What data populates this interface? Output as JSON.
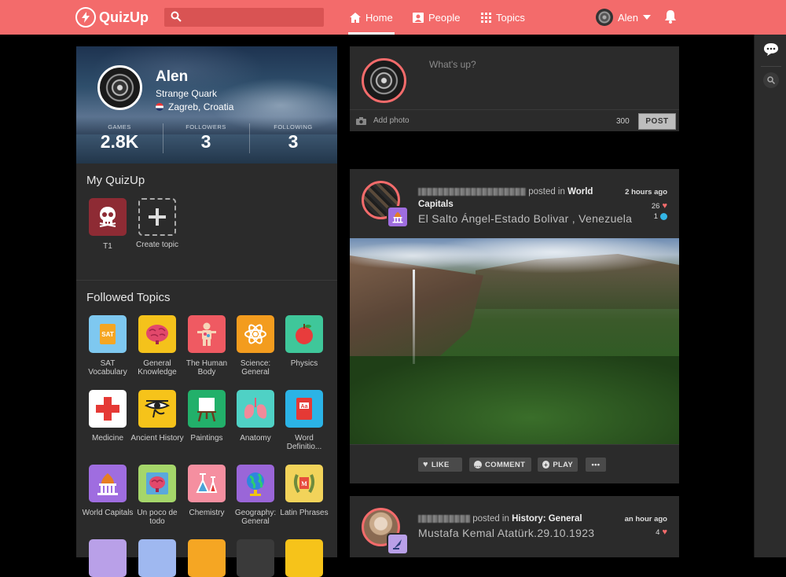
{
  "app": {
    "name": "QuizUp"
  },
  "search": {
    "placeholder": ""
  },
  "nav": {
    "home": "Home",
    "people": "People",
    "topics": "Topics"
  },
  "user": {
    "name": "Alen"
  },
  "profile": {
    "name": "Alen",
    "title": "Strange Quark",
    "location": "Zagreb, Croatia",
    "stats": [
      {
        "label": "GAMES",
        "value": "2.8K"
      },
      {
        "label": "FOLLOWERS",
        "value": "3"
      },
      {
        "label": "FOLLOWING",
        "value": "3"
      }
    ]
  },
  "my_quizup": {
    "title": "My QuizUp",
    "items": [
      {
        "label": "T1"
      },
      {
        "label": "Create topic"
      }
    ]
  },
  "followed": {
    "title": "Followed Topics",
    "topics": [
      {
        "label": "SAT Vocabulary",
        "color": "#7ec8f0"
      },
      {
        "label": "General Knowledge",
        "color": "#f4c21b"
      },
      {
        "label": "The Human Body",
        "color": "#ef5a62"
      },
      {
        "label": "Science: General",
        "color": "#f39c1e"
      },
      {
        "label": "Physics",
        "color": "#3fc79a"
      },
      {
        "label": "Medicine",
        "color": "#ffffff"
      },
      {
        "label": "Ancient History",
        "color": "#f6c31a"
      },
      {
        "label": "Paintings",
        "color": "#22b06a"
      },
      {
        "label": "Anatomy",
        "color": "#4fd1c5"
      },
      {
        "label": "Word Definitio...",
        "color": "#2bb3e6"
      },
      {
        "label": "World Capitals",
        "color": "#9f6de0"
      },
      {
        "label": "Un poco de todo",
        "color": "#a5d66a"
      },
      {
        "label": "Chemistry",
        "color": "#f58fa0"
      },
      {
        "label": "Geography: General",
        "color": "#9a66d8"
      },
      {
        "label": "Latin Phrases",
        "color": "#f2d35a"
      }
    ]
  },
  "composer": {
    "placeholder": "What's up?",
    "add_photo": "Add photo",
    "count": "300",
    "post": "POST"
  },
  "feed": [
    {
      "posted_in": "posted in",
      "topic": "World Capitals",
      "topic_line1": "World",
      "topic_line2": "Capitals",
      "time": "2 hours ago",
      "likes": "26",
      "comments": "1",
      "headline": "El Salto Ángel-Estado Bolivar , Venezuela",
      "actions": {
        "like": "LIKE",
        "comment": "COMMENT",
        "play": "PLAY",
        "more": "•••"
      }
    },
    {
      "posted_in": "posted in",
      "topic": "History: General",
      "time": "an hour ago",
      "likes": "4",
      "headline": "Mustafa Kemal Atatürk.29.10.1923"
    }
  ],
  "colors": {
    "brand": "#f36b6b",
    "panel": "#2b2b2b",
    "background": "#000000"
  }
}
